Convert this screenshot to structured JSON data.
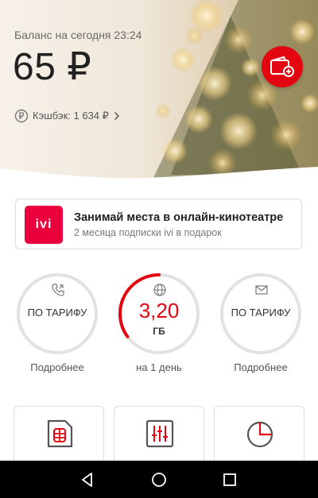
{
  "balance": {
    "label": "Баланс на сегодня 23:24",
    "amount": "65 ₽",
    "cashback": "Кэшбэк: 1 634 ₽"
  },
  "promo": {
    "logo_text": "ivi",
    "title": "Занимай места в онлайн-кинотеатре",
    "subtitle": "2 месяца подписки ivi в подарок"
  },
  "counters": [
    {
      "icon": "phone-icon",
      "value": "ПО ТАРИФУ",
      "caption": "Подробнее"
    },
    {
      "icon": "globe-icon",
      "value": "3,20",
      "unit": "ГБ",
      "caption": "на 1 день",
      "remaining_fraction": 0.35
    },
    {
      "icon": "envelope-icon",
      "value": "ПО ТАРИФУ",
      "caption": "Подробнее"
    }
  ],
  "tiles": [
    {
      "icon": "sim-card-icon"
    },
    {
      "icon": "tariff-sliders-icon"
    },
    {
      "icon": "pie-chart-icon"
    }
  ],
  "navbar": {
    "back": "back-icon",
    "home": "home-icon",
    "recents": "recents-icon"
  },
  "colors": {
    "accent": "#e30611",
    "promo_logo": "#ea003d"
  }
}
